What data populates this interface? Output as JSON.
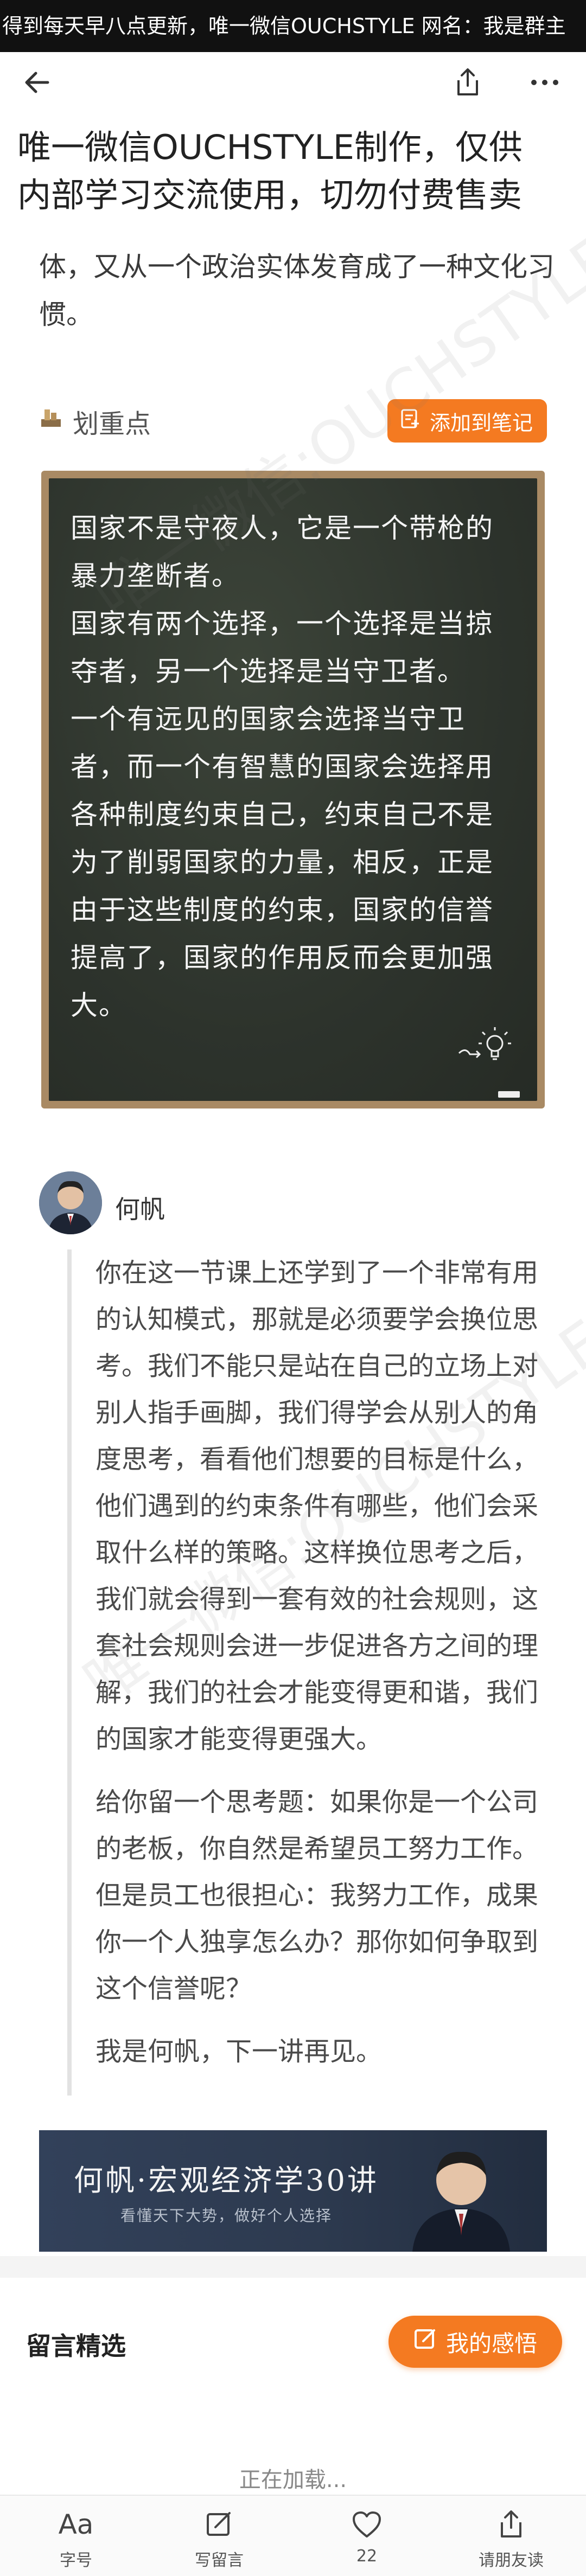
{
  "banner": {
    "text": "得到每天早八点更新，唯一微信OUCHSTYLE 网名：我是群主"
  },
  "nav": {
    "back_icon": "back-arrow-icon",
    "share_icon": "share-icon",
    "more_icon": "more-icon"
  },
  "article": {
    "title_line1": "唯一微信OUCHSTYLE制作，仅供",
    "title_line2": "内部学习交流使用，切勿付费售卖",
    "paragraph": "体，又从一个政治实体发育成了一种文化习惯。",
    "highlight_label": "划重点",
    "add_note_label": "添加到笔记",
    "board_lines": [
      "国家不是守夜人，它是一个带枪的暴力垄断者。",
      "国家有两个选择，一个选择是当掠夺者，另一个选择是当守卫者。",
      "一个有远见的国家会选择当守卫者，而一个有智慧的国家会选择用各种制度约束自己，约束自己不是为了削弱国家的力量，相反，正是由于这些制度的约束，国家的信誉提高了，国家的作用反而会更加强大。"
    ],
    "author_name": "何帆",
    "quote_paragraphs": [
      "你在这一节课上还学到了一个非常有用的认知模式，那就是必须要学会换位思考。我们不能只是站在自己的立场上对别人指手画脚，我们得学会从别人的角度思考，看看他们想要的目标是什么，他们遇到的约束条件有哪些，他们会采取什么样的策略。这样换位思考之后，我们就会得到一套有效的社会规则，这套社会规则会进一步促进各方之间的理解，我们的社会才能变得更和谐，我们的国家才能变得更强大。",
      "给你留一个思考题：如果你是一个公司的老板，你自然是希望员工努力工作。但是员工也很担心：我努力工作，成果你一个人独享怎么办？那你如何争取到这个信誉呢？",
      "我是何帆，下一讲再见。"
    ],
    "course_title": "何帆·宏观经济学30讲",
    "course_subtitle": "看懂天下大势，做好个人选择",
    "watermark": "唯一微信:OUCHSTYLE"
  },
  "comments": {
    "section_label": "留言精选",
    "my_feel_label": "我的感悟",
    "loading_text": "正在加载..."
  },
  "bottom_bar": {
    "tabs": [
      {
        "label": "字号",
        "icon": "font-size-icon"
      },
      {
        "label": "写留言",
        "icon": "write-icon"
      },
      {
        "label": "22",
        "icon": "heart-icon"
      },
      {
        "label": "请朋友读",
        "icon": "share-icon"
      }
    ]
  },
  "colors": {
    "accent": "#f47a21",
    "board": "#2f362e",
    "board_frame": "#a98a64",
    "course_bg": "#2f3d52"
  }
}
